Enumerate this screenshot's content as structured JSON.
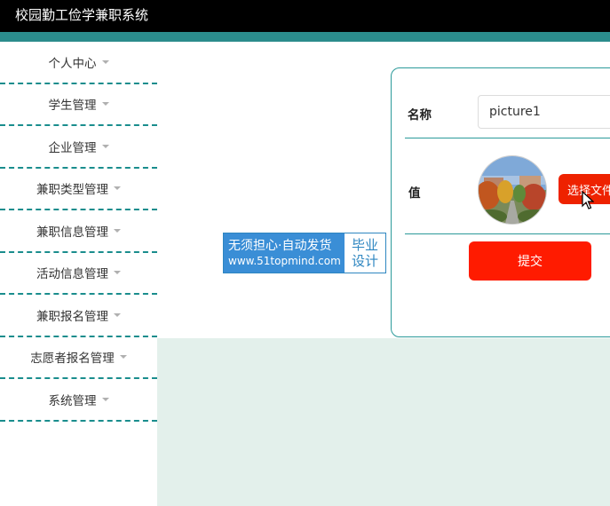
{
  "app": {
    "title": "校园勤工俭学兼职系统"
  },
  "sidebar": {
    "items": [
      {
        "label": "个人中心"
      },
      {
        "label": "学生管理"
      },
      {
        "label": "企业管理"
      },
      {
        "label": "兼职类型管理"
      },
      {
        "label": "兼职信息管理"
      },
      {
        "label": "活动信息管理"
      },
      {
        "label": "兼职报名管理"
      },
      {
        "label": "志愿者报名管理"
      },
      {
        "label": "系统管理"
      }
    ]
  },
  "form": {
    "name_label": "名称",
    "name_value": "picture1",
    "value_label": "值",
    "choose_file_label": "选择文件",
    "submit_label": "提交"
  },
  "watermark": {
    "line1": "无须担心·自动发货",
    "line2": "www.51topmind.com",
    "right_line1": "毕业",
    "right_line2": "设计"
  },
  "colors": {
    "topbar": "#000000",
    "accent": "#2b8c8c",
    "button": "#ff1b00",
    "content_bg": "#e3f0eb"
  }
}
